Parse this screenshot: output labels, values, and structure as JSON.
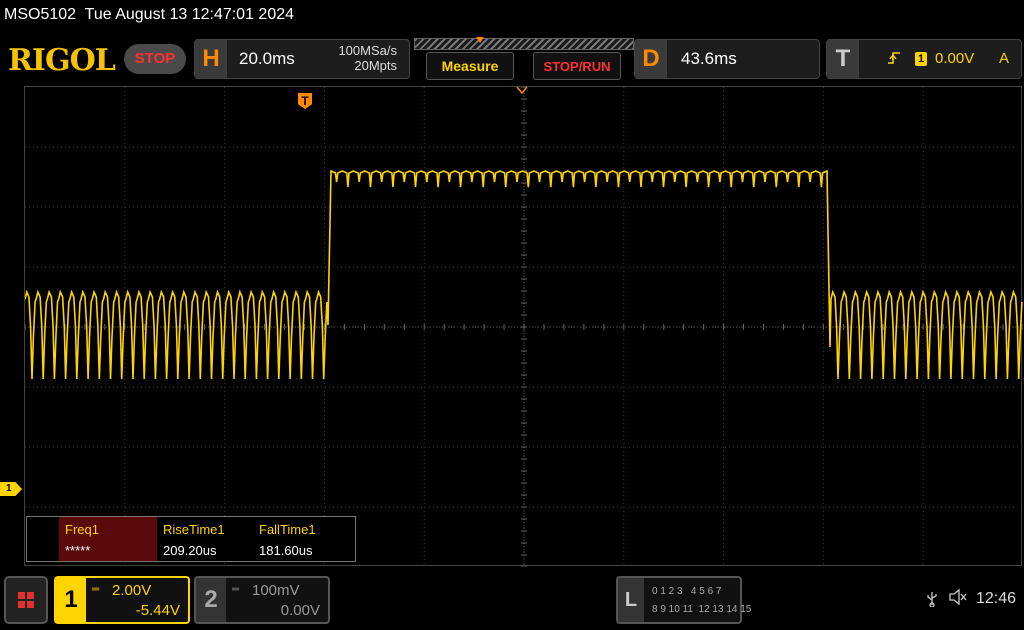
{
  "header": {
    "model": "MSO5102",
    "datetime": "Tue August 13 12:47:01 2024"
  },
  "topbar": {
    "logo": "RIGOL",
    "run_state": "STOP",
    "horizontal": {
      "letter": "H",
      "timebase": "20.0ms",
      "sample_rate": "100MSa/s",
      "memory_depth": "20Mpts"
    },
    "measure_label": "Measure",
    "stoprun_label": "STOP/RUN",
    "delay": {
      "letter": "D",
      "value": "43.6ms"
    },
    "trigger": {
      "letter": "T",
      "source": "1",
      "level": "0.00V",
      "mode": "A",
      "slope_icon": "rising-edge-icon"
    }
  },
  "waveform": {
    "channel_marker": "1",
    "trigger_position_marker": "T",
    "color": "#ffd400"
  },
  "measurements": [
    {
      "label": "Freq1",
      "value": "*****"
    },
    {
      "label": "RiseTime1",
      "value": "209.20us"
    },
    {
      "label": "FallTime1",
      "value": "181.60us"
    }
  ],
  "bottombar": {
    "ch1": {
      "number": "1",
      "scale": "2.00V",
      "offset": "-5.44V"
    },
    "ch2": {
      "number": "2",
      "scale": "100mV",
      "offset": "0.00V"
    },
    "logic": {
      "letter": "L",
      "row1": "0 1 2 3   4 5 6 7",
      "row2": "8 9 10 11  12 13 14 15"
    },
    "clock": "12:46"
  },
  "colors": {
    "accent": "#ffd400",
    "orange": "#ff8a00",
    "stop_red": "#ff3030"
  }
}
